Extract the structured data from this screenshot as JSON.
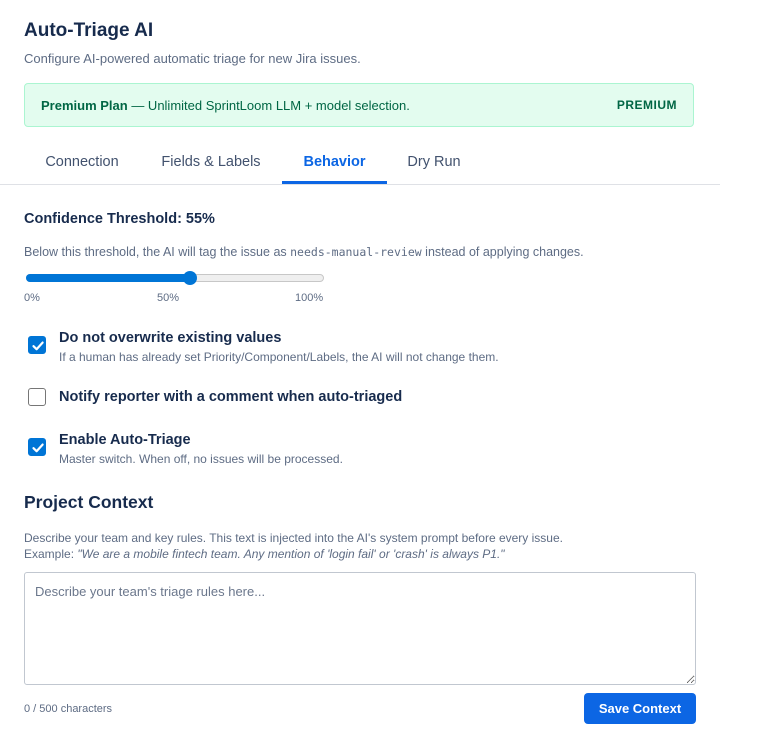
{
  "header": {
    "title": "Auto-Triage AI",
    "subtitle": "Configure AI-powered automatic triage for new Jira issues."
  },
  "banner": {
    "plan_name": "Premium Plan",
    "plan_desc": " — Unlimited SprintLoom LLM + model selection.",
    "badge": "PREMIUM"
  },
  "tabs": [
    {
      "label": "Connection",
      "active": false
    },
    {
      "label": "Fields & Labels",
      "active": false
    },
    {
      "label": "Behavior",
      "active": true
    },
    {
      "label": "Dry Run",
      "active": false
    }
  ],
  "threshold": {
    "label": "Confidence Threshold: ",
    "value_text": "55%",
    "value": 55,
    "help_before": "Below this threshold, the AI will tag the issue as ",
    "help_code": "needs-manual-review",
    "help_after": " instead of applying changes.",
    "scale_min": "0%",
    "scale_mid": "50%",
    "scale_max": "100%"
  },
  "options": [
    {
      "title": "Do not overwrite existing values",
      "desc": "If a human has already set Priority/Component/Labels, the AI will not change them.",
      "checked": true
    },
    {
      "title": "Notify reporter with a comment when auto-triaged",
      "desc": "",
      "checked": false
    },
    {
      "title": "Enable Auto-Triage",
      "desc": "Master switch. When off, no issues will be processed.",
      "checked": true
    }
  ],
  "context": {
    "title": "Project Context",
    "help": "Describe your team and key rules. This text is injected into the AI's system prompt before every issue.",
    "example_prefix": "Example: ",
    "example": "\"We are a mobile fintech team. Any mention of 'login fail' or 'crash' is always P1.\"",
    "placeholder": "Describe your team's triage rules here...",
    "value": "",
    "counter": "0 / 500 characters",
    "save_label": "Save Context"
  },
  "colors": {
    "accent": "#0c66e4",
    "slider": "#0075d6",
    "banner_bg": "#e3fcef",
    "banner_text": "#006644"
  }
}
